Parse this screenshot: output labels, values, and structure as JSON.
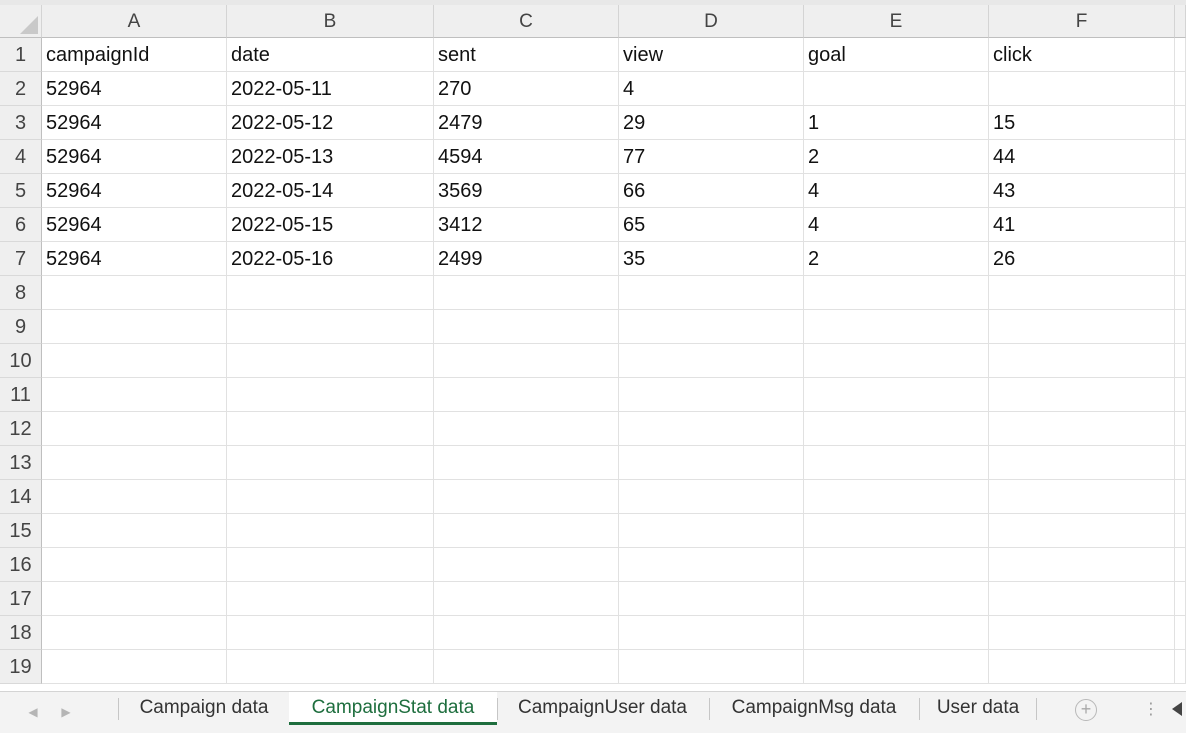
{
  "columns": [
    "A",
    "B",
    "C",
    "D",
    "E",
    "F"
  ],
  "row_numbers": [
    "1",
    "2",
    "3",
    "4",
    "5",
    "6",
    "7",
    "8",
    "9",
    "10",
    "11",
    "12",
    "13",
    "14",
    "15",
    "16",
    "17",
    "18",
    "19"
  ],
  "rows": [
    [
      "campaignId",
      "date",
      "sent",
      "view",
      "goal",
      "click"
    ],
    [
      "52964",
      "2022-05-11",
      "270",
      "4",
      "",
      ""
    ],
    [
      "52964",
      "2022-05-12",
      "2479",
      "29",
      "1",
      "15"
    ],
    [
      "52964",
      "2022-05-13",
      "4594",
      "77",
      "2",
      "44"
    ],
    [
      "52964",
      "2022-05-14",
      "3569",
      "66",
      "4",
      "43"
    ],
    [
      "52964",
      "2022-05-15",
      "3412",
      "65",
      "4",
      "41"
    ],
    [
      "52964",
      "2022-05-16",
      "2499",
      "35",
      "2",
      "26"
    ],
    [
      "",
      "",
      "",
      "",
      "",
      ""
    ],
    [
      "",
      "",
      "",
      "",
      "",
      ""
    ],
    [
      "",
      "",
      "",
      "",
      "",
      ""
    ],
    [
      "",
      "",
      "",
      "",
      "",
      ""
    ],
    [
      "",
      "",
      "",
      "",
      "",
      ""
    ],
    [
      "",
      "",
      "",
      "",
      "",
      ""
    ],
    [
      "",
      "",
      "",
      "",
      "",
      ""
    ],
    [
      "",
      "",
      "",
      "",
      "",
      ""
    ],
    [
      "",
      "",
      "",
      "",
      "",
      ""
    ],
    [
      "",
      "",
      "",
      "",
      "",
      ""
    ],
    [
      "",
      "",
      "",
      "",
      "",
      ""
    ],
    [
      "",
      "",
      "",
      "",
      "",
      ""
    ]
  ],
  "sheet_tabs": [
    {
      "label": "Campaign data",
      "active": false
    },
    {
      "label": "CampaignStat data",
      "active": true
    },
    {
      "label": "CampaignUser data",
      "active": false
    },
    {
      "label": "CampaignMsg data",
      "active": false
    },
    {
      "label": "User data",
      "active": false
    }
  ],
  "nav": {
    "prev_icon": "◀",
    "next_icon": "▶",
    "add_icon": "+",
    "more_icon": "⋮"
  },
  "colors": {
    "active_tab": "#1e6e3e",
    "header_bg": "#efefef",
    "gridline": "#e1e1e1"
  }
}
